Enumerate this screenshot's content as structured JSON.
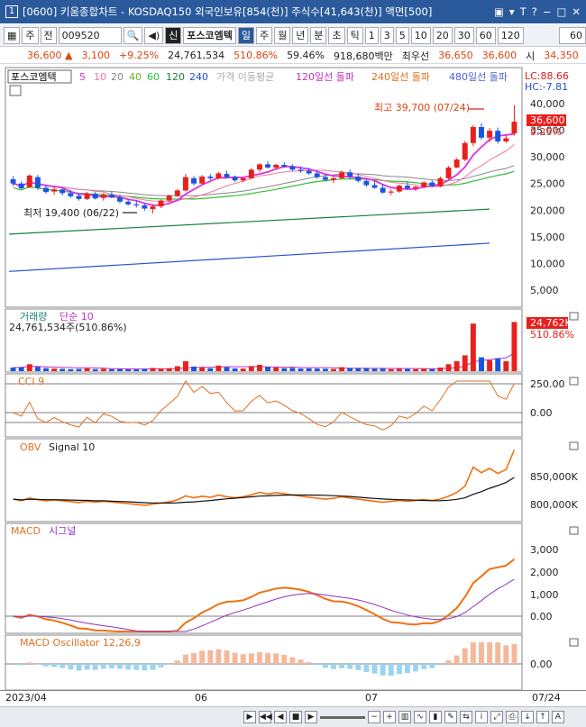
{
  "title": {
    "screen_num": "1",
    "text": "[0600] 키움종합차트 - KOSDAQ150 외국인보유[854(천)] 주식수[41,643(천)] 액면[500]"
  },
  "title_icons": [
    "window-icon",
    "dropdown-icon",
    "t-icon",
    "help-icon",
    "minimize-icon",
    "maximize-icon",
    "close-icon"
  ],
  "toolbar": {
    "type_options": [
      "주",
      "전"
    ],
    "code": "009520",
    "stock_tag": "신",
    "stock_name": "포스코엠텍",
    "periods": [
      "일",
      "주",
      "월",
      "년",
      "분",
      "초",
      "틱"
    ],
    "active_period": "일",
    "intervals": [
      "1",
      "3",
      "5",
      "10",
      "20",
      "30",
      "60",
      "120"
    ],
    "count_value": "60"
  },
  "price_row": {
    "price": "36,600 ▲",
    "change": "3,100",
    "change_pct": "+9.25%",
    "volume": "24,761,534",
    "vol_ratio": "510.86%",
    "vol_pct": "59.46%",
    "amount": "918,680백만",
    "best_label": "최우선",
    "ask": "36,650",
    "bid": "36,600",
    "open_label": "시",
    "open": "34,350",
    "high_label": "고"
  },
  "price_panel": {
    "label": "포스코엠텍",
    "ma_labels": [
      "5",
      "10",
      "20",
      "40",
      "60",
      "120",
      "240"
    ],
    "ma_colors": [
      "#e030e0",
      "#f07aa0",
      "#888888",
      "#6ab020",
      "#30c030",
      "#1a8040",
      "#2050d0"
    ],
    "ma_legend_text": "가격 이동평균",
    "signal_120": "120일선 돌파",
    "signal_240": "240일선 돌파",
    "signal_480": "480일선 돌파",
    "lc": "LC:88.66",
    "hc": "HC:-7.81",
    "high_note": "최고 39,700 (07/24)",
    "low_note": "최저 19,400 (06/22)",
    "last_price_tag": "36,600",
    "last_pct_tag": "9.25%",
    "yticks": [
      "40,000",
      "35,000",
      "30,000",
      "25,000",
      "20,000",
      "15,000",
      "10,000",
      "5,000"
    ]
  },
  "volume_panel": {
    "label": "거래량",
    "ma_label": "단순 10",
    "value_text": "24,761,534주(510.86%)",
    "tag_value": "24,762K",
    "tag_pct": "510.86%"
  },
  "cci_panel": {
    "label": "CCI 9",
    "yticks": [
      "250.00",
      "0.00"
    ]
  },
  "obv_panel": {
    "label": "OBV",
    "signal": "Signal 10",
    "yticks": [
      "850,000K",
      "800,000K"
    ]
  },
  "macd_panel": {
    "label": "MACD",
    "signal": "시그널",
    "yticks": [
      "3,000",
      "2,000",
      "1,000",
      "0.00"
    ]
  },
  "osc_panel": {
    "label": "MACD Oscillator 12,26,9",
    "yticks": [
      "0.00"
    ]
  },
  "xaxis": {
    "labels": [
      "2023/04",
      "06",
      "07"
    ],
    "last_date": "07/24"
  },
  "colors": {
    "up": "#e8201b",
    "down": "#1a55e0",
    "accent": "#2a5a9c",
    "macd": "#f07010",
    "signal": "#9030c0",
    "osc": "#f4b89a",
    "osc_neg": "#9ad4f0"
  },
  "chart_data": {
    "type": "candlestick",
    "candles": [
      [
        25.8,
        26.4,
        24.5,
        25.0
      ],
      [
        25.0,
        25.4,
        23.9,
        24.1
      ],
      [
        24.3,
        26.7,
        24.1,
        26.5
      ],
      [
        26.2,
        26.6,
        23.8,
        24.2
      ],
      [
        24.2,
        24.7,
        23.1,
        23.4
      ],
      [
        23.5,
        24.4,
        22.9,
        23.9
      ],
      [
        23.9,
        24.2,
        22.8,
        23.2
      ],
      [
        23.2,
        23.8,
        22.3,
        22.6
      ],
      [
        22.7,
        23.1,
        21.8,
        22.1
      ],
      [
        22.1,
        23.4,
        21.9,
        23.1
      ],
      [
        23.1,
        23.4,
        22.0,
        22.2
      ],
      [
        22.3,
        23.2,
        21.8,
        22.9
      ],
      [
        22.9,
        23.5,
        22.2,
        22.4
      ],
      [
        22.4,
        22.9,
        21.3,
        21.6
      ],
      [
        21.6,
        22.1,
        20.8,
        21.1
      ],
      [
        21.1,
        21.8,
        20.5,
        20.9
      ],
      [
        20.9,
        21.3,
        19.9,
        20.3
      ],
      [
        20.2,
        21.0,
        19.4,
        20.7
      ],
      [
        20.7,
        22.0,
        20.4,
        21.8
      ],
      [
        21.8,
        22.9,
        21.5,
        22.7
      ],
      [
        22.7,
        24.0,
        22.5,
        23.7
      ],
      [
        23.7,
        26.8,
        23.5,
        26.2
      ],
      [
        26.0,
        26.4,
        24.6,
        25.0
      ],
      [
        25.0,
        26.6,
        24.8,
        26.3
      ],
      [
        26.3,
        26.8,
        25.6,
        26.0
      ],
      [
        26.0,
        27.2,
        25.8,
        26.9
      ],
      [
        26.8,
        27.4,
        25.9,
        26.2
      ],
      [
        26.2,
        26.5,
        25.3,
        25.6
      ],
      [
        25.6,
        26.2,
        25.2,
        26.0
      ],
      [
        26.0,
        27.9,
        25.9,
        27.6
      ],
      [
        27.6,
        28.8,
        27.2,
        28.6
      ],
      [
        28.6,
        29.2,
        27.8,
        28.0
      ],
      [
        28.0,
        28.7,
        27.6,
        28.5
      ],
      [
        28.5,
        29.0,
        27.9,
        28.2
      ],
      [
        28.2,
        28.6,
        27.3,
        27.6
      ],
      [
        27.6,
        28.2,
        27.0,
        27.4
      ],
      [
        27.4,
        27.9,
        26.6,
        26.9
      ],
      [
        26.9,
        27.3,
        25.9,
        26.2
      ],
      [
        26.2,
        26.7,
        25.4,
        25.7
      ],
      [
        25.7,
        26.3,
        25.1,
        26.0
      ],
      [
        26.0,
        27.4,
        25.8,
        27.1
      ],
      [
        27.1,
        27.6,
        25.9,
        26.3
      ],
      [
        26.3,
        26.8,
        25.2,
        25.5
      ],
      [
        25.5,
        25.9,
        24.4,
        24.7
      ],
      [
        24.7,
        25.4,
        24.0,
        24.2
      ],
      [
        24.2,
        24.8,
        23.1,
        23.3
      ],
      [
        23.3,
        23.9,
        22.8,
        23.5
      ],
      [
        23.5,
        24.8,
        23.3,
        24.6
      ],
      [
        24.6,
        25.2,
        23.8,
        24.1
      ],
      [
        24.1,
        24.6,
        23.6,
        24.4
      ],
      [
        24.4,
        25.4,
        24.1,
        25.2
      ],
      [
        25.2,
        25.6,
        24.3,
        24.5
      ],
      [
        24.5,
        26.3,
        24.3,
        26.0
      ],
      [
        26.0,
        28.3,
        25.8,
        28.0
      ],
      [
        28.0,
        29.8,
        27.9,
        29.5
      ],
      [
        29.5,
        33.0,
        29.2,
        32.6
      ],
      [
        32.6,
        36.0,
        32.0,
        35.6
      ],
      [
        35.6,
        36.3,
        33.2,
        33.6
      ],
      [
        33.6,
        35.4,
        32.8,
        34.9
      ],
      [
        34.9,
        35.5,
        32.5,
        32.9
      ],
      [
        32.9,
        34.2,
        32.6,
        33.5
      ],
      [
        34.4,
        39.7,
        34.0,
        36.6
      ]
    ],
    "volume": [
      1.8,
      2.0,
      3.5,
      2.2,
      1.5,
      1.3,
      1.2,
      1.0,
      1.1,
      1.4,
      1.0,
      1.2,
      1.0,
      1.1,
      0.9,
      1.0,
      1.2,
      1.6,
      1.3,
      1.5,
      2.5,
      5.0,
      2.3,
      2.0,
      1.5,
      2.8,
      2.0,
      1.4,
      1.3,
      2.5,
      3.2,
      2.2,
      1.8,
      1.5,
      1.6,
      1.3,
      1.4,
      1.3,
      1.2,
      1.1,
      2.0,
      1.6,
      1.5,
      1.4,
      1.2,
      1.3,
      1.0,
      1.2,
      1.1,
      1.0,
      1.2,
      1.1,
      1.8,
      3.5,
      5.0,
      8.0,
      24.0,
      7.0,
      5.5,
      6.5,
      5.0,
      24.8
    ],
    "ylim": [
      0,
      42.0
    ],
    "yunit": "thousand KRW"
  }
}
